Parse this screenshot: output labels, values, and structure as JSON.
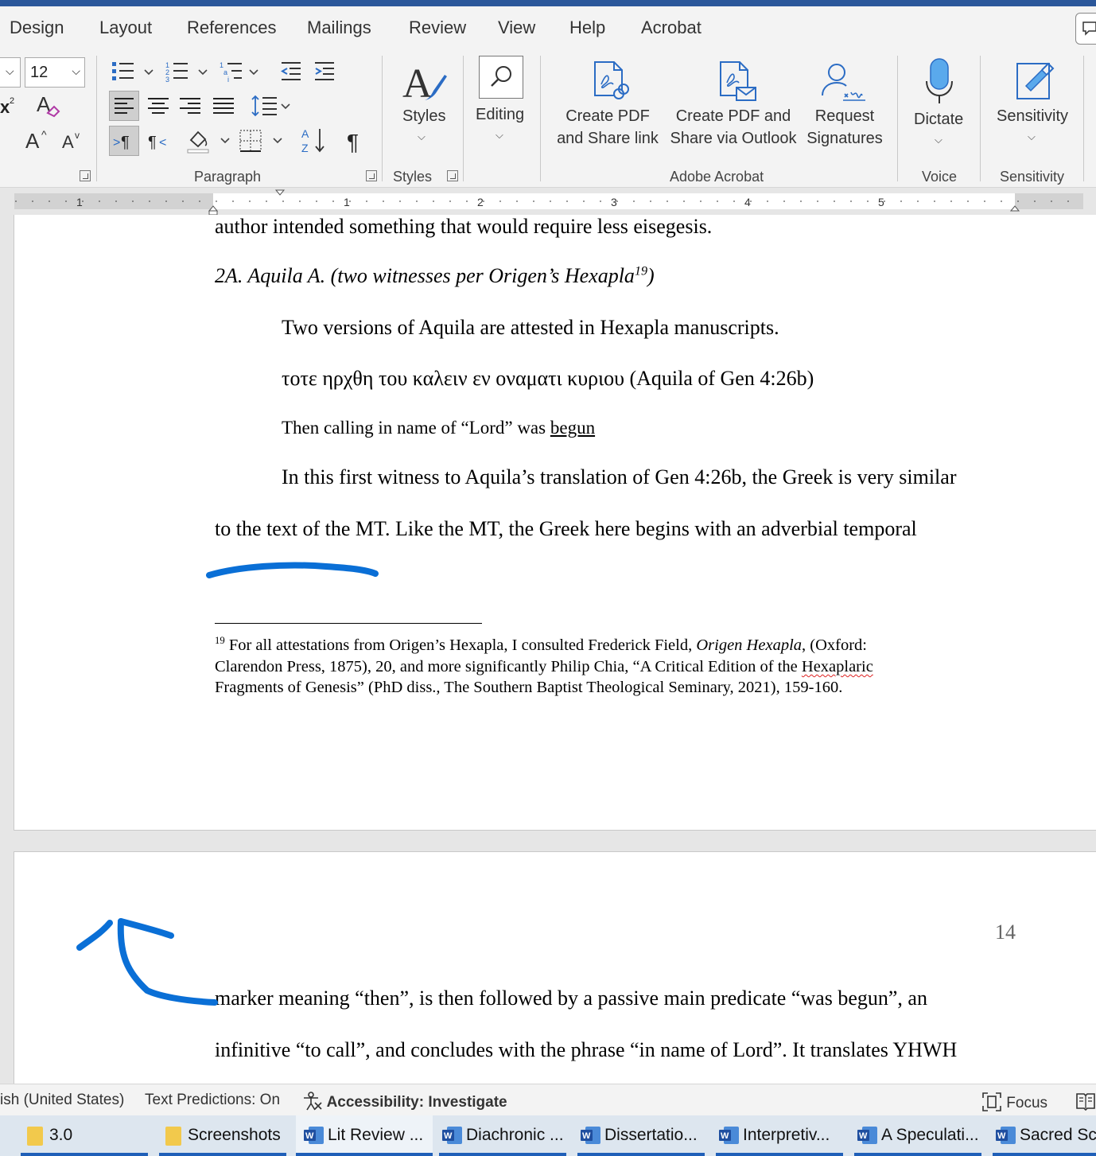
{
  "tabs": [
    "Design",
    "Layout",
    "References",
    "Mailings",
    "Review",
    "View",
    "Help",
    "Acrobat"
  ],
  "ribbon": {
    "font_size": "12",
    "groups": {
      "paragraph": "Paragraph",
      "styles": "Styles",
      "adobe": "Adobe Acrobat",
      "voice": "Voice",
      "sensitivity": "Sensitivity"
    },
    "buttons": {
      "styles": "Styles",
      "editing": "Editing",
      "create_pdf_share_link": [
        "Create PDF",
        "and Share link"
      ],
      "create_pdf_outlook": [
        "Create PDF and",
        "Share via Outlook"
      ],
      "request_signatures": [
        "Request",
        "Signatures"
      ],
      "dictate": "Dictate",
      "sensitivity": "Sensitivity"
    },
    "icons": [
      "bullets-icon",
      "numbering-icon",
      "multilevel-list-icon",
      "decrease-indent-icon",
      "increase-indent-icon",
      "align-left-icon",
      "center-icon",
      "align-right-icon",
      "justify-icon",
      "line-spacing-icon",
      "ltr-icon",
      "rtl-icon",
      "shading-icon",
      "borders-icon",
      "sort-icon",
      "show-formatting-icon",
      "superscript-icon",
      "clear-formatting-icon",
      "grow-font-icon",
      "shrink-font-icon",
      "styles-icon",
      "search-icon",
      "pdf-link-icon",
      "pdf-mail-icon",
      "signature-icon",
      "microphone-icon",
      "sensitivity-icon"
    ]
  },
  "ruler": {
    "numbers": [
      "1",
      "1",
      "2",
      "3",
      "4",
      "5"
    ]
  },
  "document": {
    "page1": {
      "line_top": "author intended something that would require less eisegesis.",
      "heading": "2A. Aquila A. (two witnesses per Origen’s Hexapla",
      "heading_sup": "19",
      "heading_close": ")",
      "p1": "Two versions of Aquila are attested in Hexapla manuscripts.",
      "greek": "τοτε ηρχθη του καλειν εν οναματι κυριου (Aquila of Gen 4:26b)",
      "translation_pre": "Then calling in name of “Lord” was ",
      "translation_underlined": "begun",
      "p2_line1": "In this first witness to Aquila’s translation of Gen 4:26b, the Greek is very similar",
      "p2_line2": "to the text of the MT. Like the MT, the Greek here begins with an adverbial temporal",
      "footnote": {
        "number": "19",
        "line1_a": " For all attestations from Origen’s Hexapla, I consulted Frederick Field, ",
        "line1_italic": "Origen Hexapla",
        "line1_b": ", (Oxford:",
        "line2_a": "Clarendon Press, 1875), 20, and more significantly Philip Chia, “A Critical Edition of the ",
        "line2_squiggle": "Hexaplaric",
        "line3": "Fragments of Genesis” (PhD diss., The Southern Baptist Theological Seminary, 2021), 159-160."
      }
    },
    "page2": {
      "page_number": "14",
      "line1": "marker meaning “then”, is then followed by a passive main predicate “was begun”, an",
      "line2": "infinitive “to call”, and concludes with the phrase “in name of Lord”. It translates YHWH"
    }
  },
  "status": {
    "language": "ish (United States)",
    "predictions": "Text Predictions: On",
    "accessibility": "Accessibility: Investigate",
    "focus": "Focus"
  },
  "taskbar": [
    {
      "label": "3.0",
      "type": "folder",
      "active": false
    },
    {
      "label": "Screenshots",
      "type": "folder",
      "active": false
    },
    {
      "label": "Lit Review ...",
      "type": "word",
      "active": true
    },
    {
      "label": "Diachronic ...",
      "type": "word",
      "active": false
    },
    {
      "label": "Dissertatio...",
      "type": "word",
      "active": false
    },
    {
      "label": "Interpretiv...",
      "type": "word",
      "active": false
    },
    {
      "label": "A Speculati...",
      "type": "word",
      "active": false
    },
    {
      "label": "Sacred Scr",
      "type": "word",
      "active": false
    }
  ],
  "colors": {
    "accent": "#2b579a",
    "ink": "#0a6fd6",
    "taskbar_bar": "#1f5fb8"
  }
}
